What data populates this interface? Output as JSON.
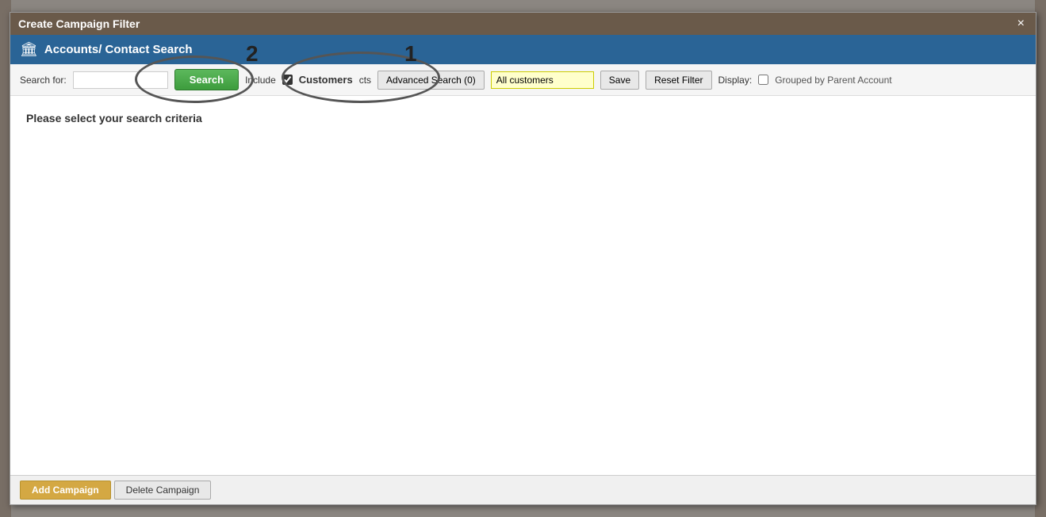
{
  "modal": {
    "titlebar": {
      "title": "Create Campaign Filter",
      "close_label": "×"
    },
    "header": {
      "icon": "🏛",
      "title": "Accounts/ Contact Search"
    },
    "toolbar": {
      "search_for_label": "Search for:",
      "search_btn_label": "Search",
      "include_label": "Include",
      "customers_label": "Customers",
      "prospects_label": "cts",
      "advanced_search_label": "Advanced Search (0)",
      "filter_name_placeholder": "All customers",
      "save_label": "Save",
      "reset_filter_label": "Reset Filter",
      "display_label": "Display:",
      "grouped_label": "Grouped by Parent Account"
    },
    "body": {
      "select_criteria_text": "Please select your search criteria"
    },
    "footer": {
      "add_campaign_label": "Add Campaign",
      "delete_campaign_label": "Delete Campaign"
    }
  },
  "annotations": {
    "number_1": "1",
    "number_2": "2"
  },
  "colors": {
    "titlebar_bg": "#6a5a4a",
    "header_bg": "#2a6496",
    "search_btn_bg": "#4cae4c",
    "filter_input_bg": "#ffffcc",
    "filter_input_border": "#cccc00"
  }
}
